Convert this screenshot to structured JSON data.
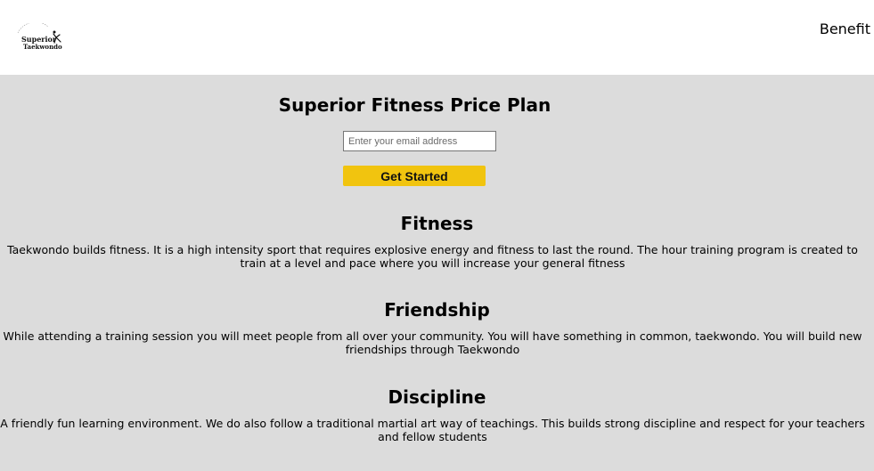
{
  "header": {
    "logo_alt": "Superior Taekwondo",
    "logo_line1": "Superior",
    "logo_line2": "Taekwondo",
    "nav": {
      "benefit_label": "Benefit"
    }
  },
  "hero": {
    "title": "Superior Fitness Price Plan",
    "email_placeholder": "Enter your email address",
    "cta_label": "Get Started"
  },
  "sections": [
    {
      "title": "Fitness",
      "body": "Taekwondo builds fitness. It is a high intensity sport that requires explosive energy and fitness to last the round. The hour training program is created to train at a level and pace where you will increase your general fitness"
    },
    {
      "title": "Friendship",
      "body": "While attending a training session you will meet people from all over your community. You will have something in common, taekwondo. You will build new friendships through Taekwondo"
    },
    {
      "title": "Discipline",
      "body": "A friendly fun learning environment. We do also follow a traditional martial art way of teachings. This builds strong discipline and respect for your teachers and fellow students"
    }
  ],
  "colors": {
    "page_background": "#dcdcdc",
    "header_background": "#ffffff",
    "cta_background": "#f1c40f"
  }
}
